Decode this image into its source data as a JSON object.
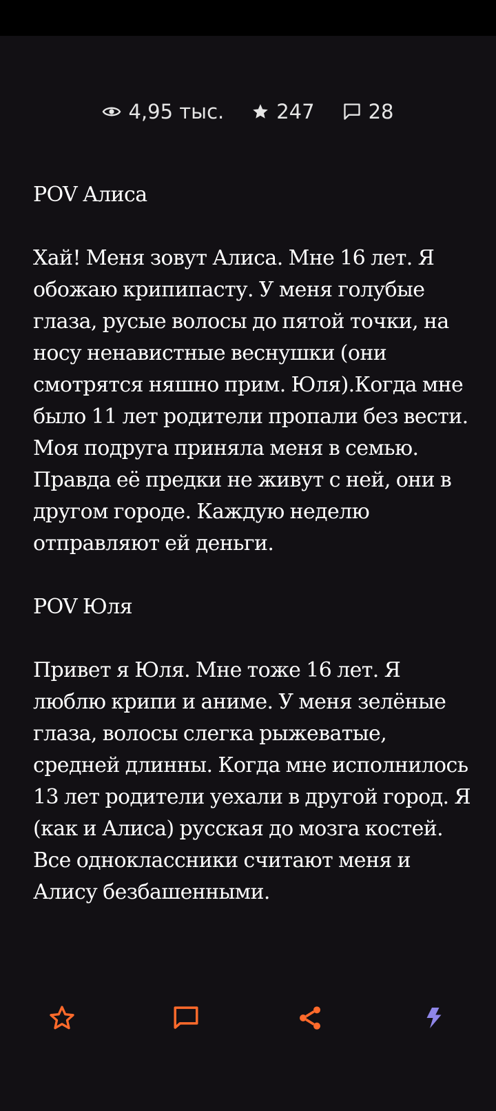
{
  "stats": {
    "views": "4,95 тыс.",
    "likes": "247",
    "comments": "28"
  },
  "story": {
    "paragraphs": [
      "POV Алиса",
      "Хай! Меня зовут Алиса. Мне 16 лет. Я обожаю крипипасту. У меня голубые глаза, русые волосы до пятой точки, на носу ненавистные веснушки (они смотрятся няшно прим. Юля).Когда мне было 11 лет родители пропали без вести. Моя подруга приняла меня в семью. Правда её предки не живут с ней, они в другом городе. Каждую неделю отправляют ей деньги.",
      "POV Юля",
      "Привет я Юля. Мне тоже 16 лет. Я люблю крипи и аниме. У меня зелёные глаза, волосы слегка рыжеватые, средней длинны. Когда мне исполнилось 13 лет родители уехали в другой город. Я (как и Алиса) русская до мозга костей. Все одноклассники считают меня и Алису безбашенными."
    ]
  },
  "icons": {
    "views": "eye-icon",
    "likes": "star-icon",
    "comments": "speech-bubble-icon",
    "favorite": "star-outline-icon",
    "comment": "comment-icon",
    "share": "share-icon",
    "boost": "lightning-icon"
  },
  "colors": {
    "background": "#121014",
    "status_bar": "#000000",
    "text": "#ffffff",
    "stats_text": "#e6e6e6",
    "accent": "#ff6a2b",
    "boost": "#8f86e8"
  }
}
